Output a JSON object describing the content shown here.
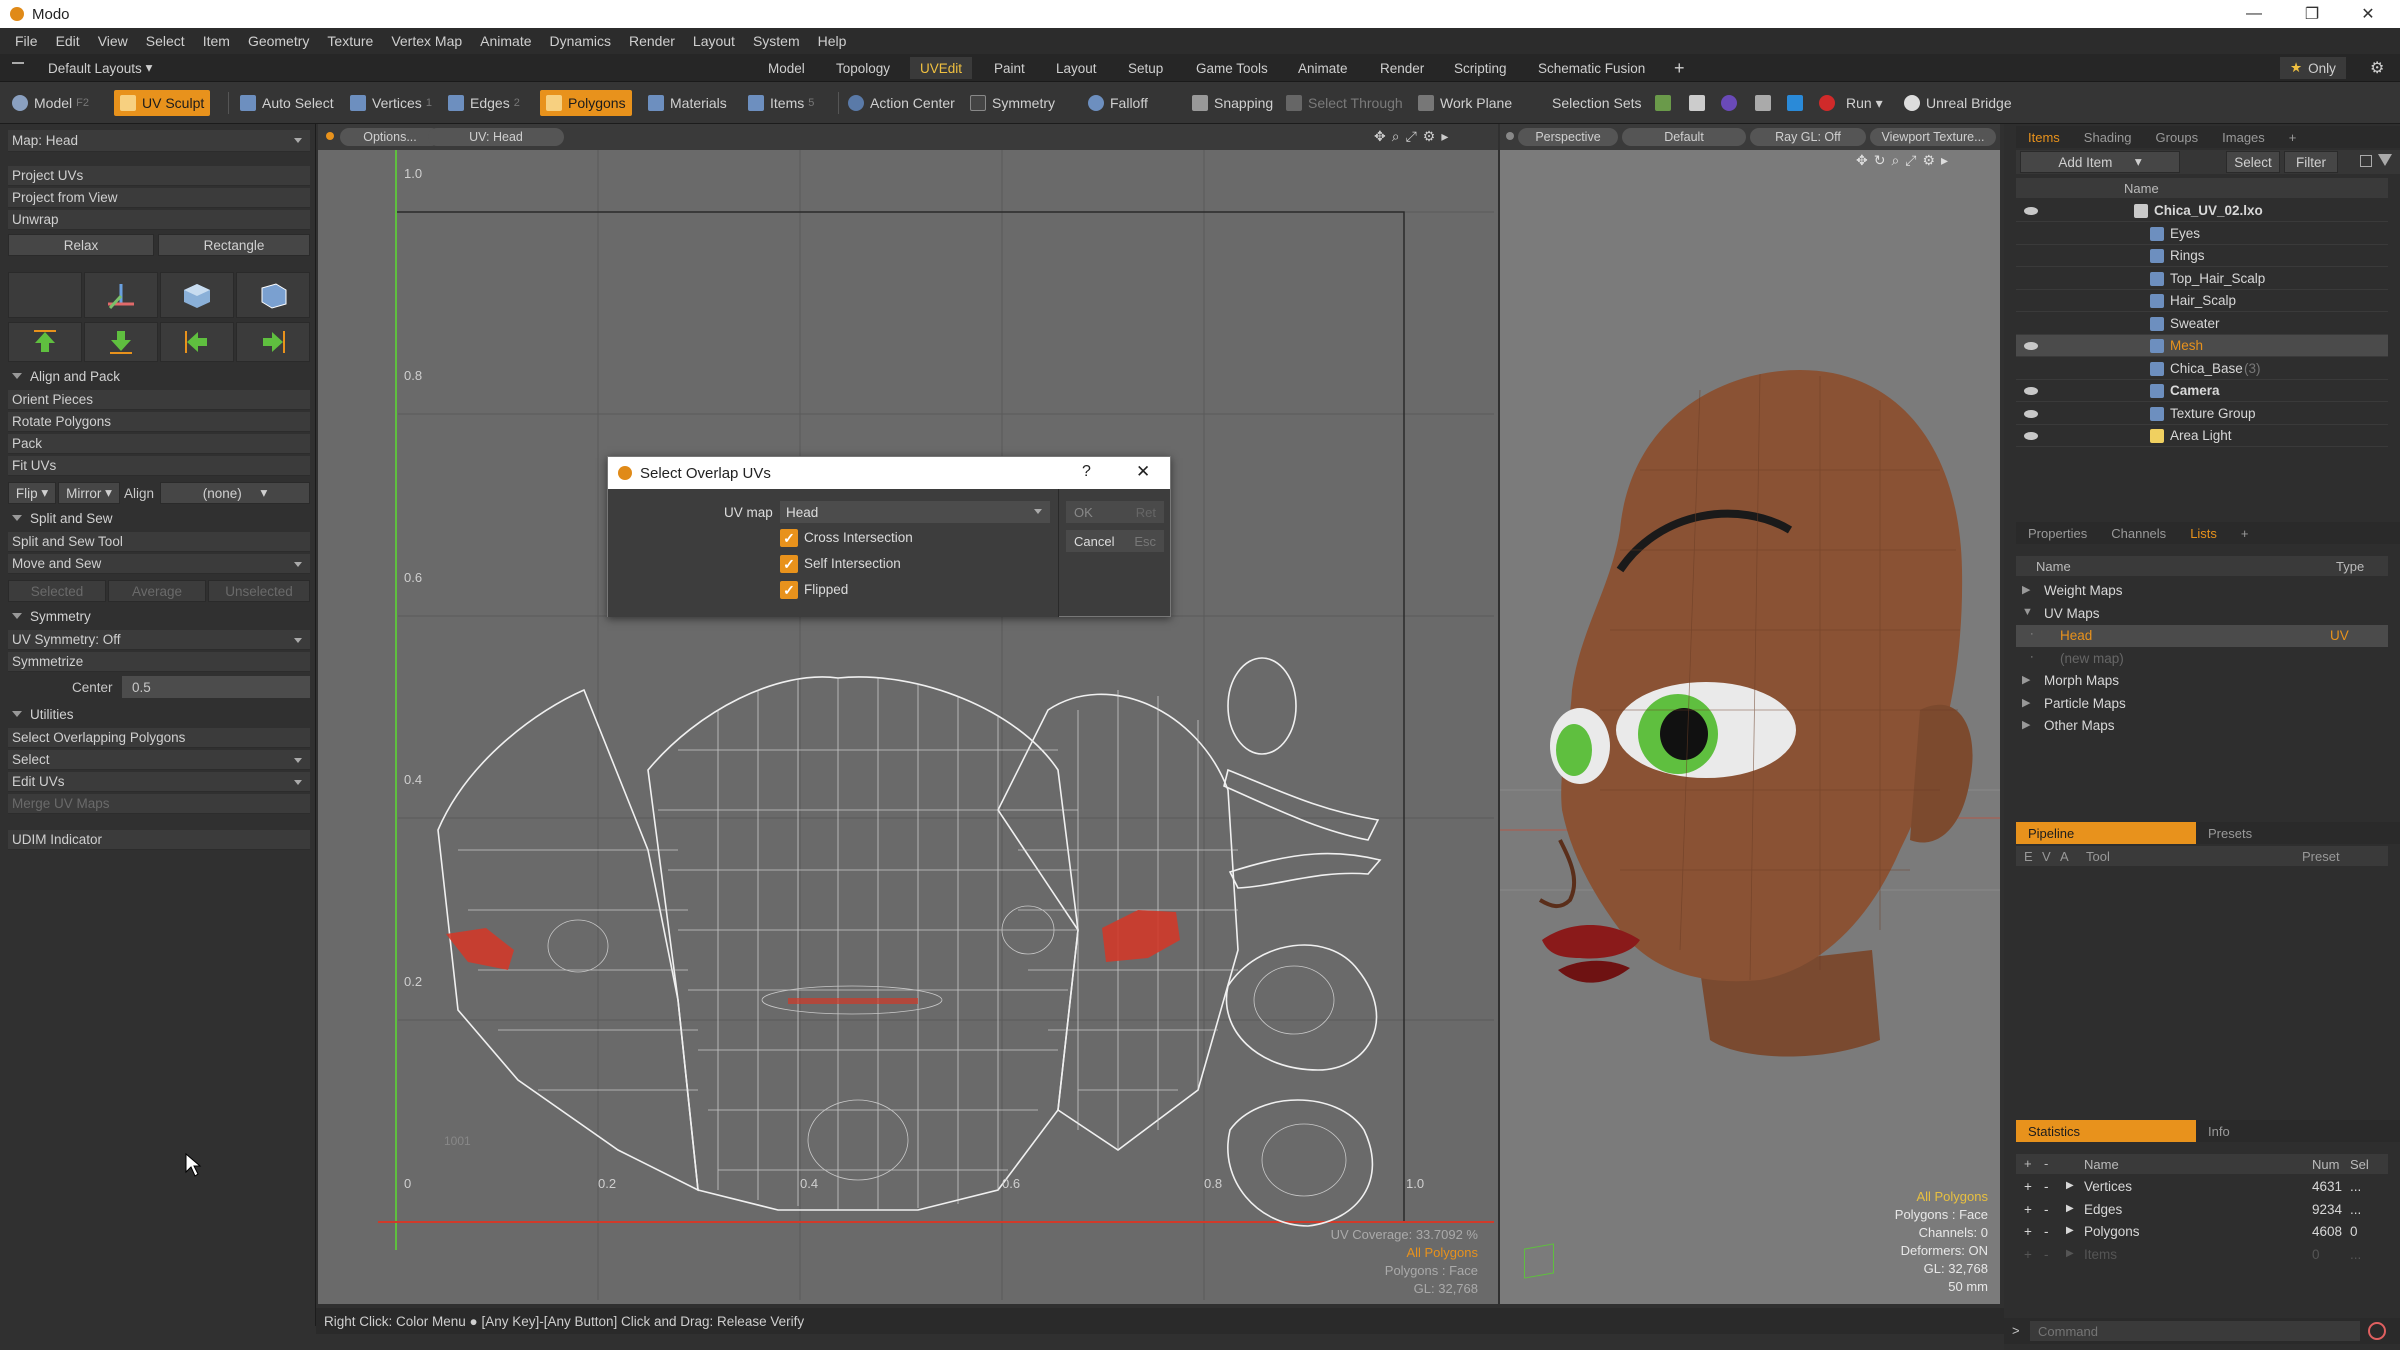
{
  "app": {
    "title": "Modo"
  },
  "menubar": [
    "File",
    "Edit",
    "View",
    "Select",
    "Item",
    "Geometry",
    "Texture",
    "Vertex Map",
    "Animate",
    "Dynamics",
    "Render",
    "Layout",
    "System",
    "Help"
  ],
  "layoutbar": {
    "layout_name": "Default Layouts",
    "tabs": [
      "Model",
      "Topology",
      "UVEdit",
      "Paint",
      "Layout",
      "Setup",
      "Game Tools",
      "Animate",
      "Render",
      "Scripting",
      "Schematic Fusion"
    ],
    "active_tab": "UVEdit",
    "only_label": "Only"
  },
  "toolbar": {
    "model": "Model",
    "model_key": "F2",
    "uv_sculpt": "UV Sculpt",
    "auto_select": "Auto Select",
    "vertices": "Vertices",
    "vertices_key": "1",
    "edges": "Edges",
    "edges_key": "2",
    "polygons": "Polygons",
    "materials": "Materials",
    "items": "Items",
    "items_key": "5",
    "action_center": "Action Center",
    "symmetry": "Symmetry",
    "falloff": "Falloff",
    "snapping": "Snapping",
    "select_through": "Select Through",
    "work_plane": "Work Plane",
    "selection_sets": "Selection Sets",
    "run": "Run",
    "unreal_bridge": "Unreal Bridge"
  },
  "leftpanel": {
    "map_selector": "Map: Head",
    "project_uvs": "Project UVs",
    "project_from_view": "Project from View",
    "unwrap": "Unwrap",
    "relax": "Relax",
    "rectangle": "Rectangle",
    "align_and_pack": "Align and Pack",
    "orient_pieces": "Orient Pieces",
    "rotate_polygons": "Rotate Polygons",
    "pack": "Pack",
    "fit_uvs": "Fit UVs",
    "flip": "Flip",
    "mirror": "Mirror",
    "align": "Align",
    "align_value": "(none)",
    "split_and_sew": "Split and Sew",
    "split_and_sew_tool": "Split and Sew Tool",
    "move_and_sew": "Move and Sew",
    "selected": "Selected",
    "average": "Average",
    "unselected": "Unselected",
    "symmetry": "Symmetry",
    "uv_symmetry": "UV Symmetry: Off",
    "symmetrize": "Symmetrize",
    "center_label": "Center",
    "center_value": "0.5",
    "utilities": "Utilities",
    "select_overlapping": "Select Overlapping Polygons",
    "select": "Select",
    "edit_uvs": "Edit UVs",
    "merge_uv_maps": "Merge UV Maps",
    "udim_indicator": "UDIM Indicator"
  },
  "uvview": {
    "options": "Options...",
    "uv_label": "UV: Head",
    "ticks_y": [
      "1.0",
      "0.8",
      "0.6",
      "0.4",
      "0.2",
      "0"
    ],
    "ticks_x": [
      "0.2",
      "0.4",
      "0.6",
      "0.8",
      "1.0"
    ],
    "udim": "1001",
    "info": [
      "UV Coverage: 33.7092 %",
      "All Polygons",
      "Polygons : Face",
      "GL: 32,768"
    ]
  },
  "view3d": {
    "perspective": "Perspective",
    "default": "Default",
    "raygl": "Ray GL: Off",
    "viewport_textures": "Viewport Texture...",
    "info": [
      "All Polygons",
      "Polygons : Face",
      "Channels: 0",
      "Deformers: ON",
      "GL: 32,768",
      "50 mm"
    ]
  },
  "items_panel": {
    "tabs": [
      "Items",
      "Shading",
      "Groups",
      "Images"
    ],
    "add_item": "Add Item",
    "select": "Select",
    "filter": "Filter",
    "name_col": "Name",
    "rows": [
      {
        "label": "Chica_UV_02.lxo",
        "bold": true,
        "indent": 0
      },
      {
        "label": "Eyes",
        "indent": 1
      },
      {
        "label": "Rings",
        "indent": 1
      },
      {
        "label": "Top_Hair_Scalp",
        "indent": 1
      },
      {
        "label": "Hair_Scalp",
        "indent": 1
      },
      {
        "label": "Sweater",
        "indent": 1
      },
      {
        "label": "Mesh",
        "indent": 1,
        "selected": true
      },
      {
        "label": "Chica_Base",
        "suffix": "(3)",
        "indent": 1
      },
      {
        "label": "Camera",
        "bold": true,
        "indent": 1
      },
      {
        "label": "Texture Group",
        "indent": 1
      },
      {
        "label": "Area Light",
        "indent": 1
      }
    ]
  },
  "lists_panel": {
    "tabs": [
      "Properties",
      "Channels",
      "Lists"
    ],
    "name_col": "Name",
    "type_col": "Type",
    "rows": [
      {
        "label": "Weight Maps",
        "indent": 0
      },
      {
        "label": "UV Maps",
        "indent": 0
      },
      {
        "label": "Head",
        "indent": 1,
        "type": "UV",
        "selected": true
      },
      {
        "label": "(new map)",
        "indent": 1,
        "dim": true
      },
      {
        "label": "Morph Maps",
        "indent": 0
      },
      {
        "label": "Particle Maps",
        "indent": 0
      },
      {
        "label": "Other Maps",
        "indent": 0
      }
    ]
  },
  "pipeline_panel": {
    "tabs": [
      "Pipeline",
      "Presets"
    ],
    "cols": [
      "E",
      "V",
      "A",
      "Tool",
      "Preset"
    ]
  },
  "stats_panel": {
    "tabs": [
      "Statistics",
      "Info"
    ],
    "cols": [
      "Name",
      "Num",
      "Sel"
    ],
    "rows": [
      {
        "label": "Vertices",
        "num": "4631",
        "sel": "..."
      },
      {
        "label": "Edges",
        "num": "9234",
        "sel": "..."
      },
      {
        "label": "Polygons",
        "num": "4608",
        "sel": "0"
      },
      {
        "label": "Items",
        "num": "0",
        "sel": "...",
        "dim": true
      }
    ]
  },
  "statusbar": {
    "text": "Right Click: Color Menu ● [Any Key]-[Any Button] Click and Drag: Release Verify"
  },
  "command": {
    "placeholder": "Command"
  },
  "dialog": {
    "title": "Select Overlap UVs",
    "uv_map_label": "UV map",
    "uv_map_value": "Head",
    "checks": [
      "Cross Intersection",
      "Self Intersection",
      "Flipped"
    ],
    "ok": "OK",
    "ok_key": "Ret",
    "cancel": "Cancel",
    "cancel_key": "Esc",
    "help": "?",
    "close": "✕"
  },
  "colors": {
    "accent": "#e8921c",
    "selection": "#e8921c",
    "uv_axis_green": "#5fbf3f",
    "uv_axis_red": "#d03a2a"
  }
}
